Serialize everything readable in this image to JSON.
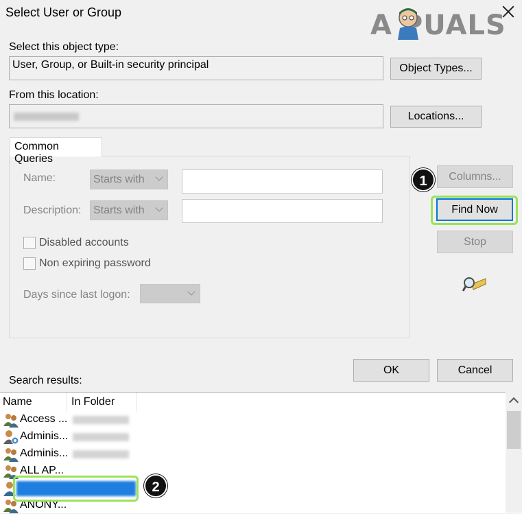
{
  "window": {
    "title": "Select User or Group"
  },
  "watermark": {
    "text": "A  PUALS"
  },
  "object_type": {
    "label": "Select this object type:",
    "value": "User, Group, or Built-in security principal",
    "button": "Object Types..."
  },
  "location": {
    "label": "From this location:",
    "value": "",
    "button": "Locations..."
  },
  "common_queries": {
    "tab_label": "Common Queries",
    "name_label": "Name:",
    "name_mode": "Starts with",
    "name_value": "",
    "description_label": "Description:",
    "description_mode": "Starts with",
    "description_value": "",
    "disabled_accounts": "Disabled accounts",
    "non_expiring_password": "Non expiring password",
    "days_label": "Days since last logon:",
    "days_value": ""
  },
  "side_buttons": {
    "columns": "Columns...",
    "find_now": "Find Now",
    "stop": "Stop"
  },
  "dialog_buttons": {
    "ok": "OK",
    "cancel": "Cancel"
  },
  "callouts": {
    "one": "1",
    "two": "2"
  },
  "results": {
    "label": "Search results:",
    "columns": [
      "Name",
      "In Folder"
    ],
    "rows": [
      {
        "name": "Access ...",
        "icon": "group-icon"
      },
      {
        "name": "Adminis...",
        "icon": "admin-user-icon"
      },
      {
        "name": "Adminis...",
        "icon": "group-icon"
      },
      {
        "name": "ALL AP...",
        "icon": "group-icon"
      },
      {
        "name": "",
        "icon": "user-icon",
        "selected": true
      },
      {
        "name": "ANONY...",
        "icon": "group-icon"
      }
    ]
  },
  "colors": {
    "accent": "#0078d7",
    "highlight": "#9be25a",
    "selection": "#1e7fe0"
  }
}
